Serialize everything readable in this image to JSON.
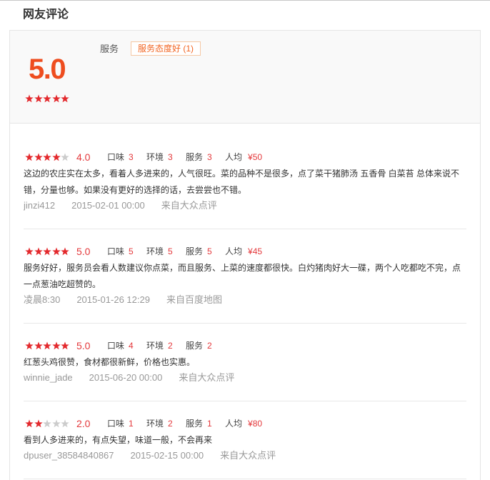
{
  "section_title": "网友评论",
  "star_max": 5,
  "colors": {
    "score_text": "#ee4d1f",
    "accent_red": "#e4393c",
    "star_filled": "#e3292d",
    "star_empty": "#cccccc",
    "tag_text": "#f26522",
    "tag_border": "#f5c8a4",
    "muted_text": "#999999"
  },
  "summary": {
    "score": "5.0",
    "stars": 5,
    "category_label": "服务",
    "tags": [
      {
        "label": "服务态度好 (1)"
      }
    ]
  },
  "reviews": [
    {
      "stars": 4,
      "score": "4.0",
      "sub_scores": [
        {
          "label": "口味",
          "value": "3"
        },
        {
          "label": "环境",
          "value": "3"
        },
        {
          "label": "服务",
          "value": "3"
        }
      ],
      "avg_price": {
        "label": "人均",
        "value": "¥50"
      },
      "text_lines": [
        "这边的农庄实在太多，看着人多进来的，人气很旺。菜的品种不是很多，点了菜干猪肺汤 五香骨 白菜苔 总体来说不",
        "错，分量也够。如果没有更好的选择的话，去尝尝也不错。"
      ],
      "author": "jinzi412",
      "date": "2015-02-01 00:00",
      "source": "来自大众点评"
    },
    {
      "stars": 5,
      "score": "5.0",
      "sub_scores": [
        {
          "label": "口味",
          "value": "5"
        },
        {
          "label": "环境",
          "value": "5"
        },
        {
          "label": "服务",
          "value": "5"
        }
      ],
      "avg_price": {
        "label": "人均",
        "value": "¥45"
      },
      "text_lines": [
        "服务好好，服务员会看人数建议你点菜，而且服务、上菜的速度都很快。白灼猪肉好大一碟，两个人吃都吃不完，点",
        "一点葱油吃超赞的。"
      ],
      "author": "凌晨8:30",
      "date": "2015-01-26 12:29",
      "source": "来自百度地图"
    },
    {
      "stars": 5,
      "score": "5.0",
      "sub_scores": [
        {
          "label": "口味",
          "value": "4"
        },
        {
          "label": "环境",
          "value": "2"
        },
        {
          "label": "服务",
          "value": "2"
        }
      ],
      "text_lines": [
        "红葱头鸡很赞，食材都很新鲜，价格也实惠。"
      ],
      "author": "winnie_jade",
      "date": "2015-06-20 00:00",
      "source": "来自大众点评"
    },
    {
      "stars": 2,
      "score": "2.0",
      "sub_scores": [
        {
          "label": "口味",
          "value": "1"
        },
        {
          "label": "环境",
          "value": "2"
        },
        {
          "label": "服务",
          "value": "1"
        }
      ],
      "avg_price": {
        "label": "人均",
        "value": "¥80"
      },
      "text_lines": [
        "看到人多进来的，有点失望，味道一般，不会再来"
      ],
      "author": "dpuser_38584840867",
      "date": "2015-02-15 00:00",
      "source": "来自大众点评"
    }
  ]
}
